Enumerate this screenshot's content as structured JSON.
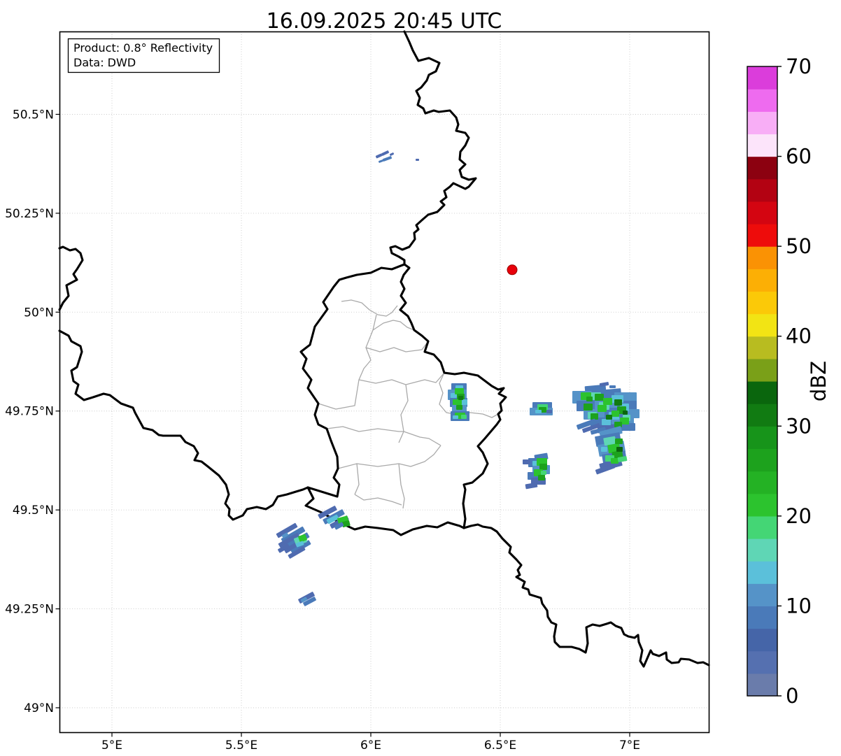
{
  "title": "16.09.2025 20:45 UTC",
  "info_box": {
    "line1": "Product: 0.8° Reflectivity",
    "line2": "Data: DWD"
  },
  "map": {
    "x_ticks": [
      {
        "label": "5°E",
        "lon": 5.0
      },
      {
        "label": "5.5°E",
        "lon": 5.5
      },
      {
        "label": "6°E",
        "lon": 6.0
      },
      {
        "label": "6.5°E",
        "lon": 6.5
      },
      {
        "label": "7°E",
        "lon": 7.0
      }
    ],
    "y_ticks": [
      {
        "label": "50.5°N",
        "lat": 50.5
      },
      {
        "label": "50.25°N",
        "lat": 50.25
      },
      {
        "label": "50°N",
        "lat": 50.0
      },
      {
        "label": "49.75°N",
        "lat": 49.75
      },
      {
        "label": "49.5°N",
        "lat": 49.5
      },
      {
        "label": "49.25°N",
        "lat": 49.25
      },
      {
        "label": "49°N",
        "lat": 49.0
      }
    ],
    "radar_site_marker": {
      "lon": 6.546,
      "lat": 50.107,
      "color": "#e8000b",
      "edge": "#990000"
    }
  },
  "colorbar": {
    "label": "dBZ",
    "min": 0,
    "max": 70,
    "tick_values": [
      0,
      10,
      20,
      30,
      40,
      50,
      60,
      70
    ],
    "segment_colors": [
      "#6a7cab",
      "#5570b0",
      "#4565a8",
      "#4a7ab9",
      "#5593c8",
      "#5bc0da",
      "#5fd6b5",
      "#44d675",
      "#2cc32e",
      "#24b224",
      "#1da21d",
      "#17941a",
      "#117b12",
      "#0a660d",
      "#7aa018",
      "#b8bc20",
      "#f2e414",
      "#fbc908",
      "#fcaf05",
      "#fa9204",
      "#ee0c0b",
      "#d40511",
      "#b30212",
      "#8c0110",
      "#fce4fa",
      "#f8aef6",
      "#ee6bef",
      "#db3ddb"
    ]
  },
  "radar_echoes": {
    "palette": {
      "b1": "#4f6bb0",
      "b2": "#4a7ab9",
      "b3": "#5593c8",
      "cy": "#5bc0da",
      "tl": "#5fd6b5",
      "tg": "#44d675",
      "g1": "#2cc32e",
      "g2": "#1da21d",
      "g3": "#117b12",
      "g4": "#0a660d"
    },
    "clusters": [
      {
        "name": "echo-north-small",
        "cells": [
          [
            537,
            221,
            9,
            4,
            "b1",
            -25
          ],
          [
            545,
            217,
            11,
            4,
            "b1",
            -25
          ],
          [
            547,
            225,
            13,
            4,
            "b2",
            -20
          ],
          [
            557,
            219,
            6,
            3,
            "b1",
            -25
          ],
          [
            541,
            229,
            7,
            3,
            "b2",
            -20
          ],
          [
            594,
            227,
            5,
            3,
            "b1",
            0
          ]
        ]
      },
      {
        "name": "echo-moselle-vertical",
        "cells": [
          [
            645,
            548,
            22,
            12,
            "b2",
            0
          ],
          [
            640,
            557,
            27,
            15,
            "b3",
            0
          ],
          [
            643,
            569,
            25,
            13,
            "b2",
            0
          ],
          [
            646,
            579,
            21,
            10,
            "b3",
            0
          ],
          [
            651,
            551,
            11,
            7,
            "cy",
            0
          ],
          [
            644,
            562,
            9,
            7,
            "cy",
            0
          ],
          [
            659,
            571,
            9,
            8,
            "cy",
            0
          ],
          [
            650,
            555,
            13,
            9,
            "g1",
            0
          ],
          [
            653,
            563,
            11,
            8,
            "g2",
            0
          ],
          [
            647,
            571,
            13,
            8,
            "g1",
            0
          ],
          [
            652,
            579,
            9,
            7,
            "g2",
            0
          ],
          [
            655,
            566,
            7,
            6,
            "g3",
            0
          ],
          [
            644,
            588,
            27,
            14,
            "b2",
            0
          ],
          [
            650,
            590,
            15,
            9,
            "g1",
            0
          ],
          [
            659,
            593,
            8,
            6,
            "tg",
            0
          ],
          [
            647,
            594,
            8,
            5,
            "cy",
            0
          ]
        ]
      },
      {
        "name": "echo-small-blob-west-of-cluster",
        "cells": [
          [
            761,
            575,
            28,
            17,
            "b2",
            0
          ],
          [
            757,
            583,
            33,
            11,
            "b3",
            0
          ],
          [
            768,
            578,
            15,
            11,
            "tg",
            0
          ],
          [
            770,
            582,
            11,
            8,
            "g2",
            0
          ],
          [
            765,
            586,
            9,
            5,
            "cy",
            0
          ],
          [
            781,
            586,
            8,
            5,
            "b1",
            0
          ]
        ]
      },
      {
        "name": "echo-big-east-cluster",
        "cells": [
          [
            836,
            551,
            30,
            11,
            "b2",
            -5
          ],
          [
            818,
            559,
            36,
            18,
            "b3",
            0
          ],
          [
            846,
            557,
            42,
            17,
            "b2",
            -5
          ],
          [
            878,
            561,
            32,
            15,
            "b3",
            0
          ],
          [
            824,
            573,
            32,
            15,
            "b2",
            0
          ],
          [
            850,
            571,
            38,
            17,
            "b3",
            0
          ],
          [
            882,
            573,
            28,
            17,
            "b2",
            0
          ],
          [
            834,
            585,
            36,
            15,
            "b3",
            0
          ],
          [
            864,
            583,
            38,
            17,
            "b2",
            0
          ],
          [
            892,
            585,
            22,
            13,
            "b3",
            0
          ],
          [
            844,
            597,
            38,
            13,
            "b2",
            0
          ],
          [
            874,
            597,
            32,
            15,
            "b3",
            0
          ],
          [
            854,
            607,
            36,
            11,
            "b1",
            -5
          ],
          [
            884,
            605,
            24,
            11,
            "b2",
            0
          ],
          [
            844,
            561,
            15,
            11,
            "tl",
            0
          ],
          [
            874,
            565,
            17,
            11,
            "cy",
            0
          ],
          [
            856,
            575,
            15,
            11,
            "tl",
            0
          ],
          [
            886,
            577,
            13,
            11,
            "cy",
            0
          ],
          [
            840,
            589,
            13,
            10,
            "tl",
            0
          ],
          [
            870,
            589,
            15,
            11,
            "cy",
            0
          ],
          [
            890,
            593,
            11,
            9,
            "tl",
            0
          ],
          [
            860,
            599,
            13,
            9,
            "cy",
            0
          ],
          [
            830,
            561,
            15,
            11,
            "g1",
            0
          ],
          [
            850,
            563,
            13,
            10,
            "g2",
            0
          ],
          [
            862,
            569,
            13,
            10,
            "g1",
            0
          ],
          [
            878,
            571,
            11,
            9,
            "g3",
            0
          ],
          [
            834,
            577,
            13,
            10,
            "g2",
            0
          ],
          [
            854,
            579,
            13,
            10,
            "g1",
            0
          ],
          [
            882,
            581,
            13,
            11,
            "g2",
            0
          ],
          [
            874,
            587,
            11,
            9,
            "g1",
            0
          ],
          [
            844,
            591,
            11,
            9,
            "g2",
            0
          ],
          [
            886,
            597,
            13,
            10,
            "g1",
            0
          ],
          [
            866,
            593,
            9,
            7,
            "g3",
            0
          ],
          [
            878,
            603,
            11,
            8,
            "g2",
            0
          ],
          [
            890,
            587,
            7,
            6,
            "g4",
            0
          ],
          [
            838,
            567,
            9,
            7,
            "g2",
            0
          ],
          [
            824,
            603,
            28,
            7,
            "b2",
            -20
          ],
          [
            832,
            609,
            26,
            6,
            "b1",
            -20
          ],
          [
            844,
            613,
            22,
            6,
            "b2",
            -15
          ],
          [
            857,
            547,
            13,
            5,
            "b1",
            -10
          ],
          [
            871,
            551,
            9,
            4,
            "b2",
            0
          ]
        ]
      },
      {
        "name": "echo-southeast-column",
        "cells": [
          [
            857,
            613,
            32,
            11,
            "b3",
            -15
          ],
          [
            851,
            621,
            36,
            15,
            "b2",
            -10
          ],
          [
            855,
            633,
            38,
            17,
            "b3",
            -10
          ],
          [
            861,
            647,
            34,
            15,
            "b2",
            -10
          ],
          [
            857,
            659,
            32,
            11,
            "b1",
            -15
          ],
          [
            851,
            667,
            28,
            7,
            "b1",
            -20
          ],
          [
            863,
            625,
            17,
            11,
            "tl",
            -10
          ],
          [
            859,
            639,
            9,
            7,
            "cy",
            0
          ],
          [
            869,
            635,
            17,
            12,
            "g1",
            -10
          ],
          [
            875,
            645,
            15,
            11,
            "g2",
            -10
          ],
          [
            865,
            651,
            13,
            9,
            "tg",
            0
          ],
          [
            873,
            655,
            11,
            8,
            "g1",
            0
          ],
          [
            879,
            627,
            11,
            8,
            "g2",
            0
          ],
          [
            881,
            639,
            9,
            7,
            "g4",
            0
          ],
          [
            883,
            653,
            13,
            7,
            "tg",
            -10
          ]
        ]
      },
      {
        "name": "echo-south-middle",
        "cells": [
          [
            764,
            649,
            19,
            9,
            "b2",
            -10
          ],
          [
            755,
            655,
            27,
            13,
            "b2",
            0
          ],
          [
            761,
            665,
            25,
            13,
            "b3",
            0
          ],
          [
            754,
            675,
            25,
            11,
            "b2",
            0
          ],
          [
            759,
            683,
            21,
            10,
            "b1",
            0
          ],
          [
            751,
            691,
            17,
            7,
            "b1",
            -10
          ],
          [
            747,
            657,
            11,
            7,
            "b1",
            0
          ],
          [
            761,
            659,
            9,
            7,
            "cy",
            0
          ],
          [
            767,
            655,
            15,
            11,
            "g1",
            0
          ],
          [
            771,
            663,
            11,
            9,
            "g2",
            0
          ],
          [
            763,
            671,
            13,
            10,
            "g1",
            0
          ],
          [
            769,
            679,
            10,
            8,
            "g2",
            0
          ],
          [
            773,
            673,
            8,
            6,
            "tg",
            0
          ]
        ]
      },
      {
        "name": "echo-streak-esch",
        "cells": [
          [
            454,
            729,
            28,
            7,
            "b1",
            -28
          ],
          [
            461,
            735,
            32,
            8,
            "b2",
            -28
          ],
          [
            471,
            743,
            28,
            7,
            "b1",
            -28
          ],
          [
            467,
            739,
            17,
            7,
            "cy",
            -28
          ],
          [
            483,
            739,
            15,
            11,
            "g1",
            -15
          ],
          [
            489,
            745,
            11,
            8,
            "g2",
            -15
          ],
          [
            478,
            749,
            13,
            6,
            "b2",
            -28
          ]
        ]
      },
      {
        "name": "echo-streaks-southwest",
        "cells": [
          [
            394,
            755,
            32,
            7,
            "b1",
            -30
          ],
          [
            401,
            761,
            36,
            8,
            "b2",
            -30
          ],
          [
            397,
            769,
            32,
            7,
            "b1",
            -30
          ],
          [
            409,
            769,
            34,
            8,
            "b2",
            -30
          ],
          [
            405,
            777,
            32,
            7,
            "b1",
            -30
          ],
          [
            415,
            779,
            30,
            7,
            "b2",
            -30
          ],
          [
            411,
            787,
            26,
            6,
            "b1",
            -30
          ],
          [
            397,
            781,
            17,
            6,
            "b1",
            -30
          ],
          [
            421,
            767,
            17,
            11,
            "tl",
            -20
          ],
          [
            427,
            765,
            11,
            9,
            "g1",
            -20
          ],
          [
            423,
            775,
            11,
            6,
            "cy",
            -20
          ],
          [
            403,
            763,
            9,
            5,
            "b3",
            -30
          ]
        ]
      },
      {
        "name": "echo-small-streak-south",
        "cells": [
          [
            426,
            851,
            24,
            7,
            "b1",
            -28
          ],
          [
            433,
            857,
            19,
            6,
            "b2",
            -28
          ],
          [
            430,
            855,
            9,
            5,
            "b3",
            -28
          ]
        ]
      }
    ]
  }
}
